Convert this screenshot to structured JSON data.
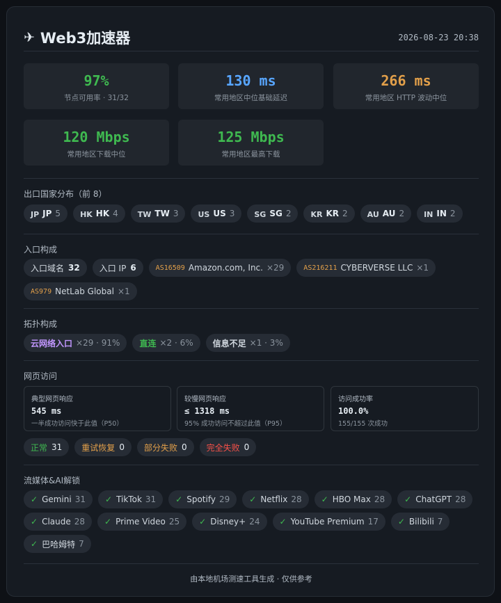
{
  "header": {
    "icon": "airplane-icon",
    "title": "Web3加速器",
    "timestamp": "2026-08-23 20:38"
  },
  "stats": [
    {
      "value": "97%",
      "label": "节点可用率 · 31/32",
      "color": "#3fb950"
    },
    {
      "value": "130 ms",
      "label": "常用地区中位基础延迟",
      "color": "#58a6ff"
    },
    {
      "value": "266 ms",
      "label": "常用地区 HTTP 波动中位",
      "color": "#e3a04a"
    },
    {
      "value": "120 Mbps",
      "label": "常用地区下载中位",
      "color": "#3fb950"
    },
    {
      "value": "125 Mbps",
      "label": "常用地区最高下载",
      "color": "#3fb950"
    }
  ],
  "countries": {
    "title": "出口国家分布（前 8）",
    "items": [
      {
        "flag": "JP",
        "code": "JP",
        "count": "5"
      },
      {
        "flag": "HK",
        "code": "HK",
        "count": "4"
      },
      {
        "flag": "TW",
        "code": "TW",
        "count": "3"
      },
      {
        "flag": "US",
        "code": "US",
        "count": "3"
      },
      {
        "flag": "SG",
        "code": "SG",
        "count": "2"
      },
      {
        "flag": "KR",
        "code": "KR",
        "count": "2"
      },
      {
        "flag": "AU",
        "code": "AU",
        "count": "2"
      },
      {
        "flag": "IN",
        "code": "IN",
        "count": "2"
      }
    ]
  },
  "entry": {
    "title": "入口构成",
    "domain_label": "入口域名",
    "domain_count": "32",
    "ip_label": "入口 IP",
    "ip_count": "6",
    "asns": [
      {
        "asn": "AS16509",
        "name": "Amazon.com, Inc.",
        "count": "×29"
      },
      {
        "asn": "AS216211",
        "name": "CYBERVERSE LLC",
        "count": "×1"
      },
      {
        "asn": "AS979",
        "name": "NetLab Global",
        "count": "×1"
      }
    ]
  },
  "topology": {
    "title": "拓扑构成",
    "items": [
      {
        "label": "云网络入口",
        "detail": "×29 · 91%",
        "color": "#c297ff"
      },
      {
        "label": "直连",
        "detail": "×2 · 6%",
        "color": "#3fb950"
      },
      {
        "label": "信息不足",
        "detail": "×1 · 3%",
        "color": "#d0d7de"
      }
    ]
  },
  "web": {
    "title": "网页访问",
    "boxes": [
      {
        "title": "典型网页响应",
        "value": "545 ms",
        "sub": "一半成功访问快于此值（P50）"
      },
      {
        "title": "较慢网页响应",
        "value": "≤ 1318 ms",
        "sub": "95% 成功访问不超过此值（P95）"
      },
      {
        "title": "访问成功率",
        "value": "100.0%",
        "sub": "155/155 次成功"
      }
    ],
    "statuses": [
      {
        "label": "正常",
        "count": "31",
        "color": "#3fb950"
      },
      {
        "label": "重试恢复",
        "count": "0",
        "color": "#e3a04a"
      },
      {
        "label": "部分失败",
        "count": "0",
        "color": "#e3a04a"
      },
      {
        "label": "完全失败",
        "count": "0",
        "color": "#f85149"
      }
    ]
  },
  "unlock": {
    "title": "流媒体&AI解锁",
    "check_icon": "check-icon",
    "items": [
      {
        "name": "Gemini",
        "count": "31"
      },
      {
        "name": "TikTok",
        "count": "31"
      },
      {
        "name": "Spotify",
        "count": "29"
      },
      {
        "name": "Netflix",
        "count": "28"
      },
      {
        "name": "HBO Max",
        "count": "28"
      },
      {
        "name": "ChatGPT",
        "count": "28"
      },
      {
        "name": "Claude",
        "count": "28"
      },
      {
        "name": "Prime Video",
        "count": "25"
      },
      {
        "name": "Disney+",
        "count": "24"
      },
      {
        "name": "YouTube Premium",
        "count": "17"
      },
      {
        "name": "Bilibili",
        "count": "7"
      },
      {
        "name": "巴哈姆特",
        "count": "7"
      }
    ]
  },
  "footer": "由本地机场测速工具生成 · 仅供参考"
}
